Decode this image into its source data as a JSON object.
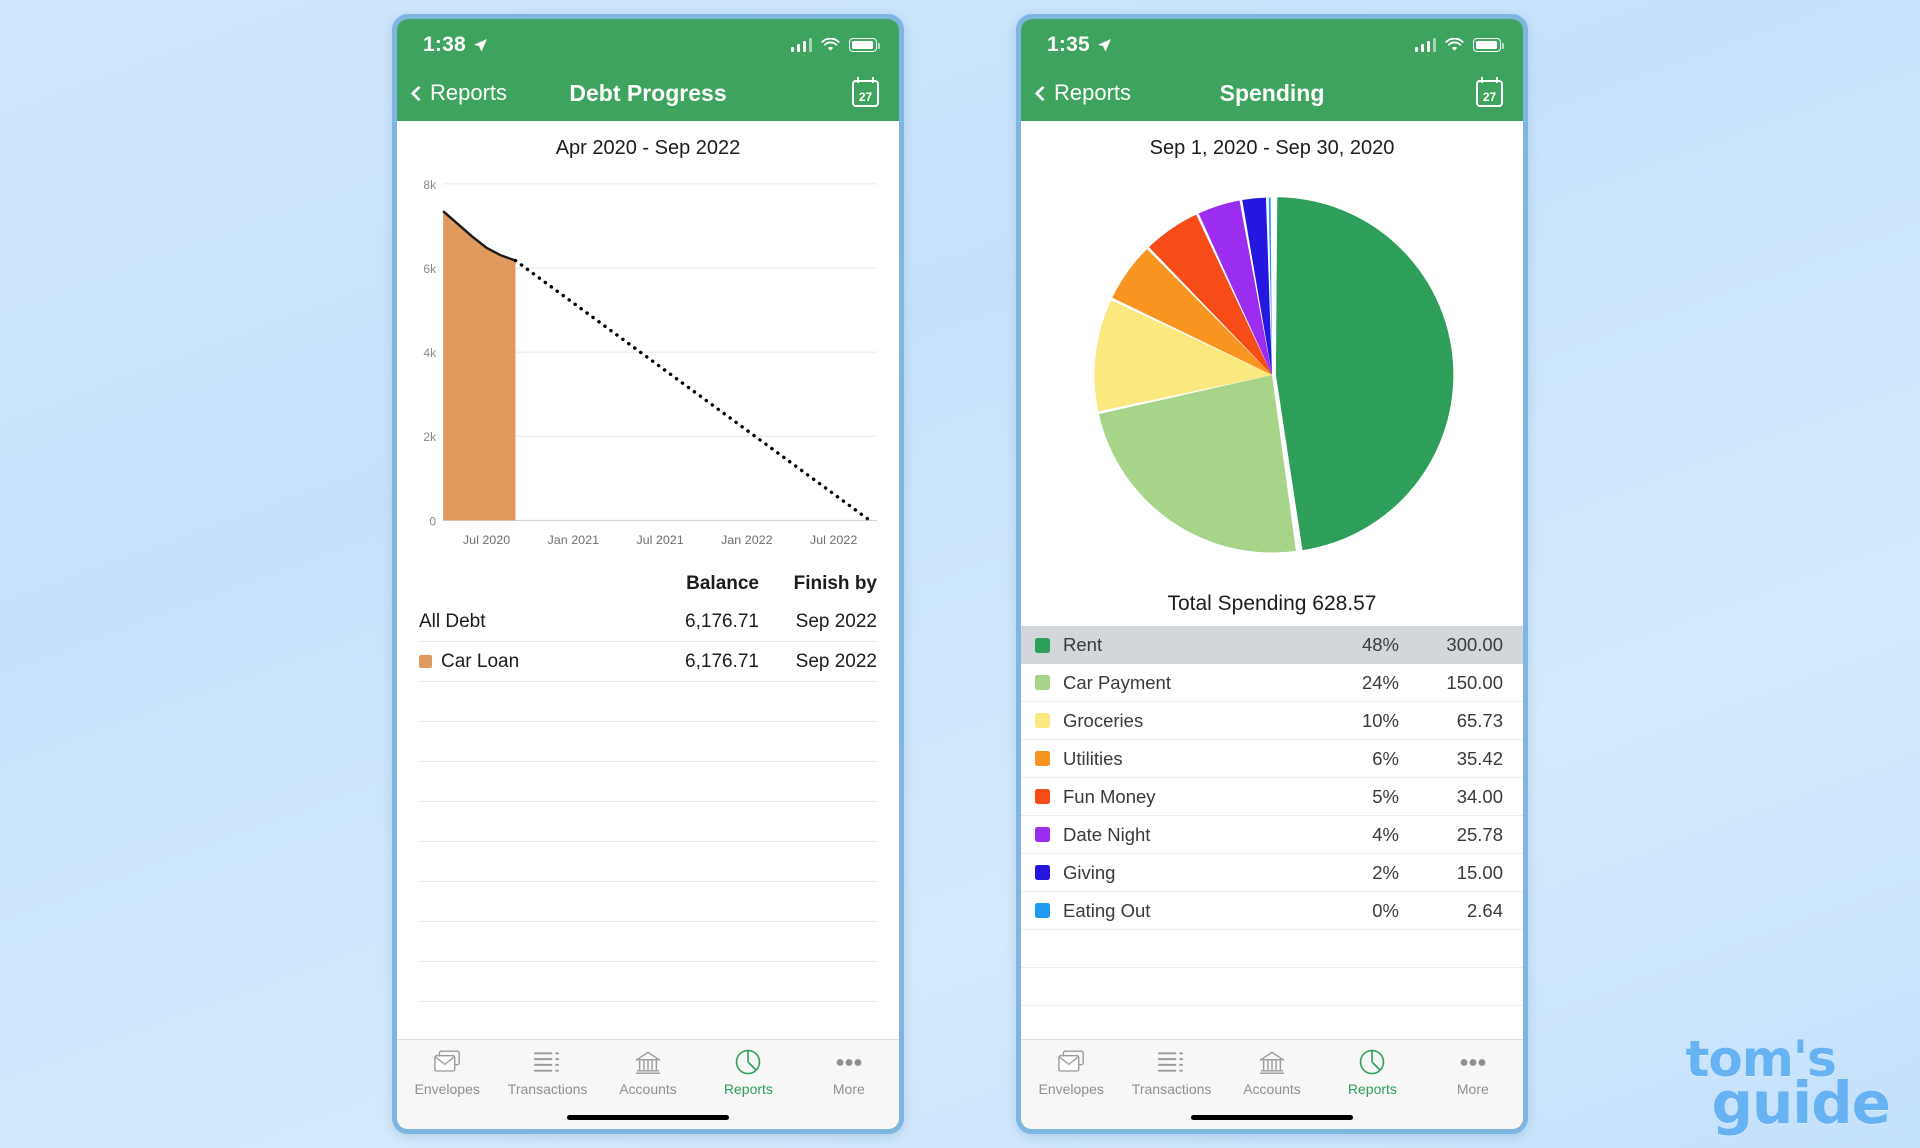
{
  "background": {
    "color": "#c9e4fb"
  },
  "watermark": {
    "line1": "tom's",
    "line2": "guide",
    "color": "#66b2f2"
  },
  "theme": {
    "header_green": "#3ea35e",
    "accent_green": "#2e9e5b",
    "debt_orange": "#e09a5e"
  },
  "phone_left": {
    "status": {
      "time": "1:38",
      "location_icon": "location-arrow-icon",
      "signal_icon": "signal-bars-icon",
      "wifi_icon": "wifi-icon",
      "battery_icon": "battery-icon"
    },
    "nav": {
      "back_label": "Reports",
      "title": "Debt Progress",
      "calendar_day": "27",
      "calendar_icon": "calendar-icon"
    },
    "chart_title": "Apr 2020 - Sep 2022",
    "table": {
      "headers": {
        "name": "",
        "balance": "Balance",
        "finish_by": "Finish by"
      },
      "rows": [
        {
          "name": "All Debt",
          "balance": "6,176.71",
          "finish_by": "Sep 2022",
          "color": ""
        },
        {
          "name": "Car Loan",
          "balance": "6,176.71",
          "finish_by": "Sep 2022",
          "color": "#e09a5e"
        }
      ],
      "empty_rows": 8
    },
    "tabs": [
      {
        "label": "Envelopes",
        "icon": "envelopes-icon",
        "active": false
      },
      {
        "label": "Transactions",
        "icon": "list-lines-icon",
        "active": false
      },
      {
        "label": "Accounts",
        "icon": "bank-building-icon",
        "active": false
      },
      {
        "label": "Reports",
        "icon": "pie-chart-icon",
        "active": true
      },
      {
        "label": "More",
        "icon": "three-dots-icon",
        "active": false
      }
    ]
  },
  "phone_right": {
    "status": {
      "time": "1:35",
      "location_icon": "location-arrow-icon",
      "signal_icon": "signal-bars-icon",
      "wifi_icon": "wifi-icon",
      "battery_icon": "battery-icon"
    },
    "nav": {
      "back_label": "Reports",
      "title": "Spending",
      "calendar_day": "27",
      "calendar_icon": "calendar-icon"
    },
    "chart_title": "Sep 1, 2020 - Sep 30, 2020",
    "total_label": "Total Spending 628.57",
    "list": [
      {
        "name": "Rent",
        "pct": "48%",
        "amount": "300.00",
        "color": "#2e9e5b",
        "highlighted": true
      },
      {
        "name": "Car Payment",
        "pct": "24%",
        "amount": "150.00",
        "color": "#a8d48a",
        "highlighted": false
      },
      {
        "name": "Groceries",
        "pct": "10%",
        "amount": "65.73",
        "color": "#fbe87f",
        "highlighted": false
      },
      {
        "name": "Utilities",
        "pct": "6%",
        "amount": "35.42",
        "color": "#f89520",
        "highlighted": false
      },
      {
        "name": "Fun Money",
        "pct": "5%",
        "amount": "34.00",
        "color": "#f74c17",
        "highlighted": false
      },
      {
        "name": "Date Night",
        "pct": "4%",
        "amount": "25.78",
        "color": "#9b2df0",
        "highlighted": false
      },
      {
        "name": "Giving",
        "pct": "2%",
        "amount": "15.00",
        "color": "#2617e0",
        "highlighted": false
      },
      {
        "name": "Eating Out",
        "pct": "0%",
        "amount": "2.64",
        "color": "#1d9bf0",
        "highlighted": false
      }
    ],
    "tabs": [
      {
        "label": "Envelopes",
        "icon": "envelopes-icon",
        "active": false
      },
      {
        "label": "Transactions",
        "icon": "list-lines-icon",
        "active": false
      },
      {
        "label": "Accounts",
        "icon": "bank-building-icon",
        "active": false
      },
      {
        "label": "Reports",
        "icon": "pie-chart-icon",
        "active": true
      },
      {
        "label": "More",
        "icon": "three-dots-icon",
        "active": false
      }
    ]
  },
  "chart_data": [
    {
      "type": "area",
      "title": "Apr 2020 - Sep 2022",
      "xlabel": "",
      "ylabel": "",
      "ylim": [
        0,
        8000
      ],
      "yticks": [
        0,
        2000,
        4000,
        6000,
        8000
      ],
      "ytick_labels": [
        "0",
        "2k",
        "4k",
        "6k",
        "8k"
      ],
      "xtick_labels": [
        "Jul 2020",
        "Jan 2021",
        "Jul 2021",
        "Jan 2022",
        "Jul 2022"
      ],
      "grid": true,
      "legend_position": "none",
      "series": [
        {
          "name": "Actual (Car Loan balance)",
          "style": "solid-filled",
          "fill_color": "#e09a5e",
          "line_color": "#1a1a1a",
          "x": [
            "Apr 2020",
            "May 2020",
            "Jun 2020",
            "Jul 2020",
            "Aug 2020",
            "Sep 2020"
          ],
          "values": [
            7350,
            7050,
            6750,
            6480,
            6300,
            6176.71
          ]
        },
        {
          "name": "Projected payoff",
          "style": "dotted",
          "line_color": "#000000",
          "x": [
            "Sep 2020",
            "Sep 2022"
          ],
          "values": [
            6176.71,
            0
          ]
        }
      ]
    },
    {
      "type": "pie",
      "title": "Sep 1, 2020 - Sep 30, 2020",
      "total": 628.57,
      "total_label": "Total Spending 628.57",
      "legend_position": "below",
      "categories": [
        "Rent",
        "Car Payment",
        "Groceries",
        "Utilities",
        "Fun Money",
        "Date Night",
        "Giving",
        "Eating Out"
      ],
      "values": [
        300.0,
        150.0,
        65.73,
        35.42,
        34.0,
        25.78,
        15.0,
        2.64
      ],
      "percentages": [
        48,
        24,
        10,
        6,
        5,
        4,
        2,
        0
      ],
      "colors": [
        "#2e9e5b",
        "#a8d48a",
        "#fbe87f",
        "#f89520",
        "#f74c17",
        "#9b2df0",
        "#2617e0",
        "#1d9bf0"
      ]
    }
  ]
}
